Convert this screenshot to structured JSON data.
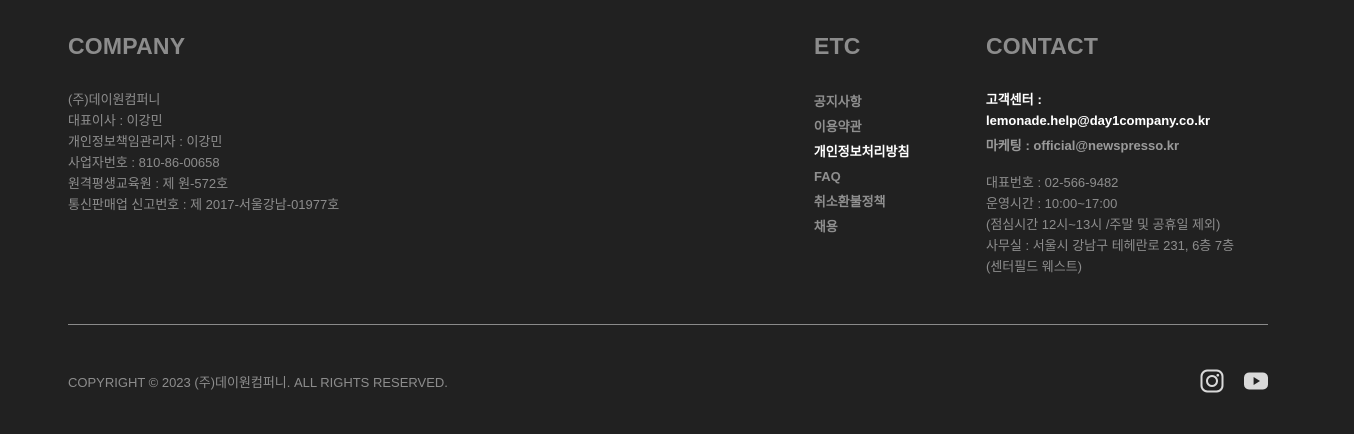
{
  "company": {
    "heading": "COMPANY",
    "lines": [
      "(주)데이원컴퍼니",
      "대표이사 : 이강민",
      "개인정보책임관리자 : 이강민",
      "사업자번호 : 810-86-00658",
      "원격평생교육원 : 제 원-572호",
      "통신판매업 신고번호 : 제 2017-서울강남-01977호"
    ]
  },
  "etc": {
    "heading": "ETC",
    "links": [
      {
        "label": "공지사항"
      },
      {
        "label": "이용약관"
      },
      {
        "label": "개인정보처리방침"
      },
      {
        "label": "FAQ"
      },
      {
        "label": "취소환불정책"
      },
      {
        "label": "채용"
      }
    ]
  },
  "contact": {
    "heading": "CONTACT",
    "customer_center_label": "고객센터 :",
    "customer_center_email": "lemonade.help@day1company.co.kr",
    "marketing": "마케팅 : official@newspresso.kr",
    "info_lines": [
      "대표번호 : 02-566-9482",
      "운영시간 : 10:00~17:00",
      "(점심시간 12시~13시 /주말 및 공휴일 제외)",
      "사무실 : 서울시 강남구 테헤란로 231, 6층 7층",
      "(센터필드 웨스트)"
    ]
  },
  "footer": {
    "copyright": "COPYRIGHT © 2023 (주)데이원컴퍼니. ALL RIGHTS RESERVED.",
    "social": [
      "instagram-icon",
      "youtube-icon"
    ]
  },
  "colors": {
    "background": "#212121",
    "text": "#8c8c8c",
    "highlight": "#ffffff"
  }
}
